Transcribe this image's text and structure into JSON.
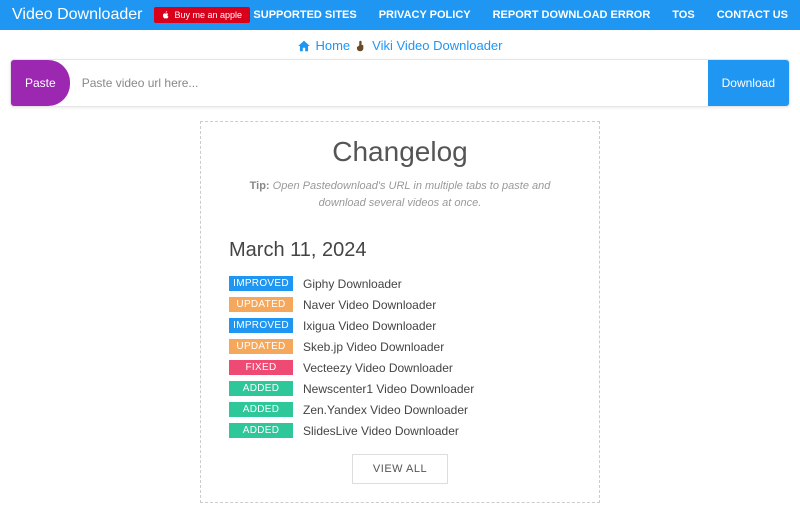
{
  "nav": {
    "brand": "Video Downloader",
    "buy_label": "Buy me an apple",
    "links": [
      "SUPPORTED SITES",
      "PRIVACY POLICY",
      "REPORT DOWNLOAD ERROR",
      "TOS",
      "CONTACT US"
    ]
  },
  "breadcrumb": {
    "home": "Home",
    "current": "Viki Video Downloader"
  },
  "urlbar": {
    "paste": "Paste",
    "placeholder": "Paste video url here...",
    "download": "Download"
  },
  "changelog": {
    "title": "Changelog",
    "tip_label": "Tip:",
    "tip_text": "Open Pastedownload's URL in multiple tabs to paste and download several videos at once.",
    "date": "March 11, 2024",
    "items": [
      {
        "badge": "IMPROVED",
        "label": "Giphy Downloader"
      },
      {
        "badge": "UPDATED",
        "label": "Naver Video Downloader"
      },
      {
        "badge": "IMPROVED",
        "label": "Ixigua Video Downloader"
      },
      {
        "badge": "UPDATED",
        "label": "Skeb.jp Video Downloader"
      },
      {
        "badge": "FIXED",
        "label": "Vecteezy Video Downloader"
      },
      {
        "badge": "ADDED",
        "label": "Newscenter1 Video Downloader"
      },
      {
        "badge": "ADDED",
        "label": "Zen.Yandex Video Downloader"
      },
      {
        "badge": "ADDED",
        "label": "SlidesLive Video Downloader"
      }
    ],
    "view_all": "VIEW ALL"
  }
}
